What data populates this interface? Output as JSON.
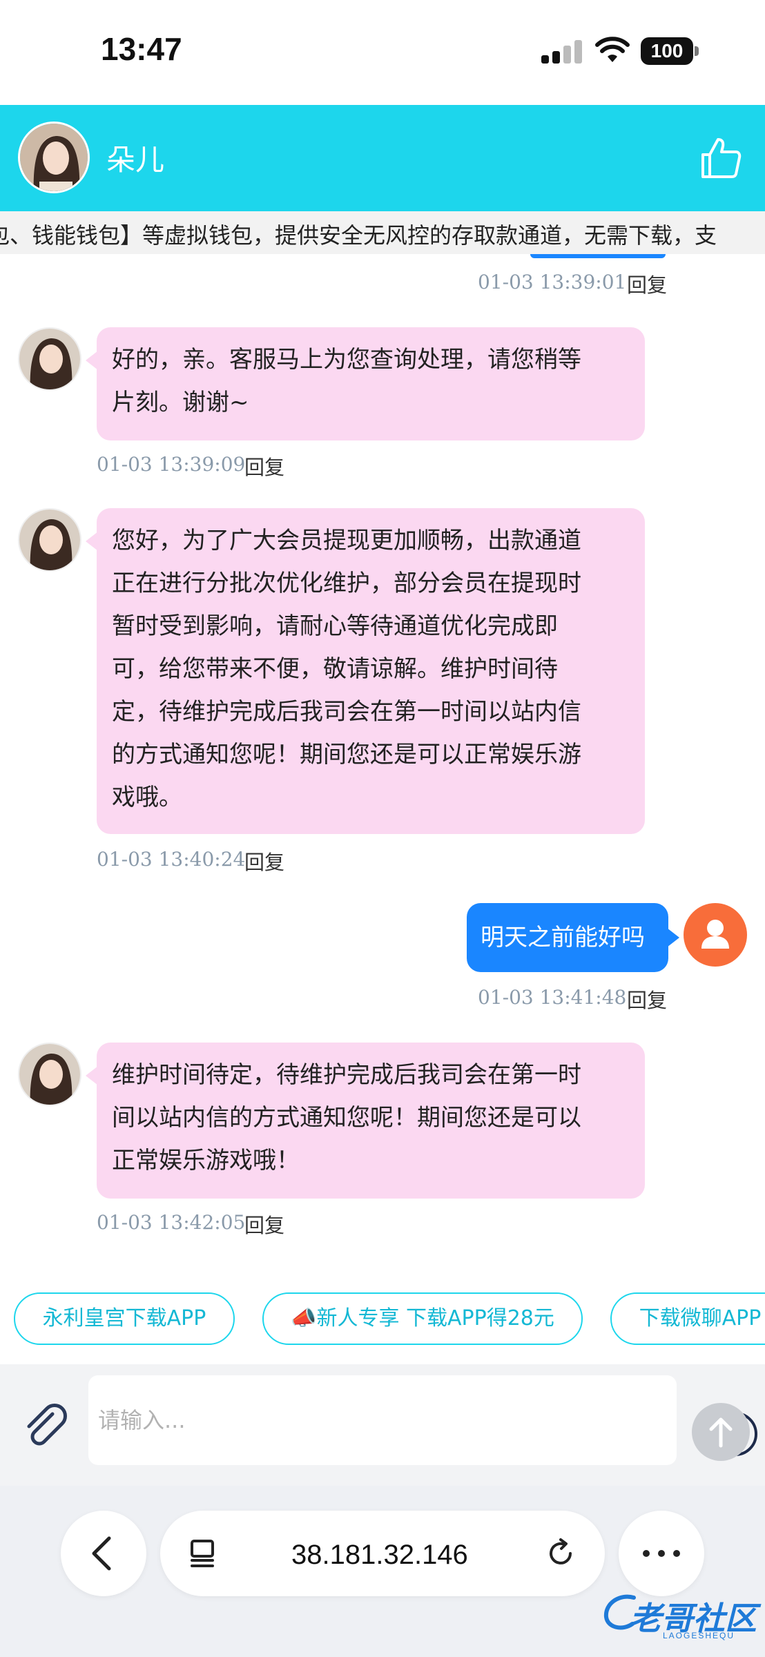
{
  "status_bar": {
    "time": "13:47",
    "battery": "100"
  },
  "header": {
    "name": "朵儿"
  },
  "notice": {
    "text": "包、钱能钱包】等虚拟钱包，提供安全无风控的存取款通道，无需下载，支"
  },
  "messages": [
    {
      "side": "left",
      "lines": [],
      "time": "01-03 13:39:01",
      "reply": "回复"
    },
    {
      "side": "left",
      "lines": [
        "好的，亲。客服马上为您查询处理，请您稍等",
        "片刻。谢谢~"
      ],
      "time": "01-03 13:39:09",
      "reply": "回复"
    },
    {
      "side": "left",
      "lines": [
        "您好，为了广大会员提现更加顺畅，出款通道",
        "正在进行分批次优化维护，部分会员在提现时",
        "暂时受到影响，请耐心等待通道优化完成即",
        "可，给您带来不便，敬请谅解。维护时间待",
        "定，待维护完成后我司会在第一时间以站内信",
        "的方式通知您呢！期间您还是可以正常娱乐游",
        "戏哦。"
      ],
      "time": "01-03 13:40:24",
      "reply": "回复"
    },
    {
      "side": "right",
      "lines": [
        "明天之前能好吗"
      ],
      "time": "01-03 13:41:48",
      "reply": "回复"
    },
    {
      "side": "left",
      "lines": [
        "维护时间待定，待维护完成后我司会在第一时",
        "间以站内信的方式通知您呢！期间您还是可以",
        "正常娱乐游戏哦！"
      ],
      "time": "01-03 13:42:05",
      "reply": "回复"
    }
  ],
  "quick_links": [
    "永利皇宫下载APP",
    "📣新人专享 下载APP得28元",
    "下载微聊APP"
  ],
  "input": {
    "placeholder": "请输入..."
  },
  "browser": {
    "address": "38.181.32.146"
  },
  "watermark": {
    "title": "老哥社区",
    "subtitle": "LAOGESHEQU"
  },
  "colors": {
    "header": "#1dd6ec",
    "agent_bubble": "#fbd8f1",
    "user_bubble": "#1a86ff",
    "user_avatar": "#f86d3a"
  }
}
